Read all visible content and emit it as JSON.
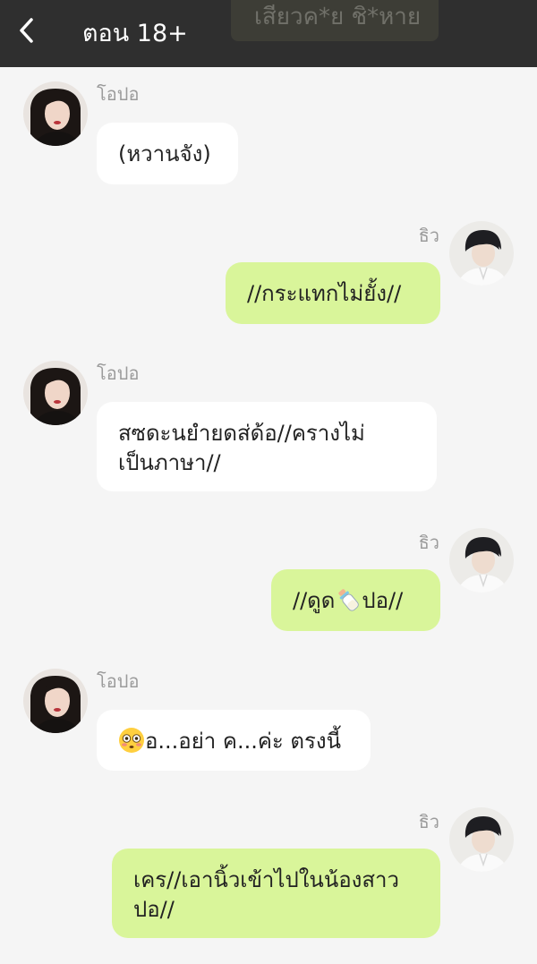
{
  "header": {
    "back_icon": "chevron-left-icon",
    "title": "ตอน 18+",
    "background_label": "เสียวค*ย ชิ*หาย"
  },
  "colors": {
    "header_bg": "#2f2f2f",
    "page_bg": "#f5f5f5",
    "left_bubble_bg": "#ffffff",
    "right_bubble_bg": "#d9f59a",
    "name_text": "#9b9b9b"
  },
  "messages": [
    {
      "side": "left",
      "sender": "โอปอ",
      "text": "(หวานจัง)"
    },
    {
      "side": "right",
      "sender": "ธิว",
      "text": "//กระแทกไม่ยั้ง//"
    },
    {
      "side": "left",
      "sender": "โอปอ",
      "text": "สซดะนยำยดส่ด้อ//ครางไม่\nเป็นภาษา//"
    },
    {
      "side": "right",
      "sender": "ธิว",
      "text_before": "//ดูด",
      "emoji": "baby-bottle-icon",
      "text_after": "ปอ//"
    },
    {
      "side": "left",
      "sender": "โอปอ",
      "emoji": "flushed-face-icon",
      "text": "อ...อย่า ค...ค่ะ ตรงนี้"
    },
    {
      "side": "right",
      "sender": "ธิว",
      "text": "เคร//เอานิ้วเข้าไปในน้องสาว\nปอ//"
    }
  ]
}
